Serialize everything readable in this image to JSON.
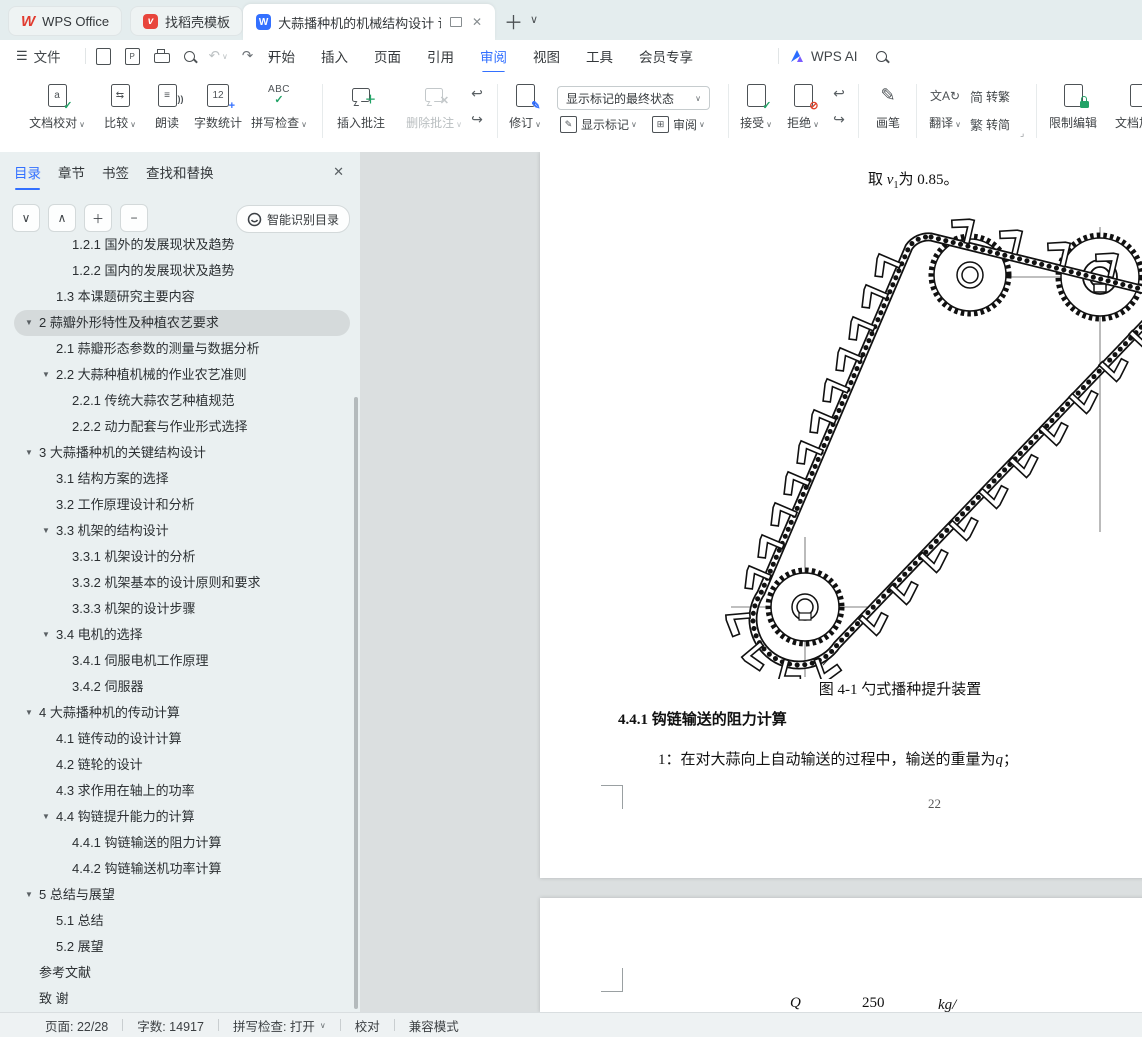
{
  "colors": {
    "accent": "#3370ff",
    "green": "#21a366",
    "red": "#e0442d"
  },
  "tabbar": {
    "tabs": [
      {
        "label": "WPS Office"
      },
      {
        "label": "找稻壳模板"
      },
      {
        "label": "大蒜播种机的机械结构设计 说"
      }
    ]
  },
  "menubar": {
    "file": "文件",
    "tabs": [
      "开始",
      "插入",
      "页面",
      "引用",
      "审阅",
      "视图",
      "工具",
      "会员专享"
    ],
    "active_tab": "审阅",
    "ai": "WPS AI"
  },
  "ribbon": {
    "proof_icon_letter": "a",
    "doc_proof": "文档校对",
    "compare": "比较",
    "read_aloud": "朗读",
    "wc_icon": "12",
    "word_count": "字数统计",
    "spell_icon": "ABC",
    "spell_check": "拼写检查",
    "insert_comment": "插入批注",
    "delete_comment": "删除批注",
    "track_changes": "修订",
    "markup_state": "显示标记的最终状态",
    "show_markup": "显示标记",
    "review_pane": "审阅",
    "accept": "接受",
    "reject": "拒绝",
    "pen": "画笔",
    "translate": "翻译",
    "s2t_icon": "简",
    "s2t": "转繁",
    "t2s_icon": "繁",
    "t2s": "转简",
    "restrict_edit": "限制编辑",
    "encrypt": "文档加密"
  },
  "sidebar": {
    "tabs": [
      "目录",
      "章节",
      "书签",
      "查找和替换"
    ],
    "active_tab": "目录",
    "smart_toc": "智能识别目录",
    "toc": [
      {
        "lv": 3,
        "label": "1.2.1 国外的发展现状及趋势"
      },
      {
        "lv": 3,
        "label": "1.2.2 国内的发展现状及趋势"
      },
      {
        "lv": 2,
        "label": "1.3 本课题研究主要内容"
      },
      {
        "lv": 1,
        "arrow": true,
        "selected": true,
        "label": "2  蒜瓣外形特性及种植农艺要求"
      },
      {
        "lv": 2,
        "label": "2.1  蒜瓣形态参数的测量与数据分析"
      },
      {
        "lv": 2,
        "arrow": true,
        "label": "2.2  大蒜种植机械的作业农艺准则"
      },
      {
        "lv": 3,
        "label": "2.2.1  传统大蒜农艺种植规范"
      },
      {
        "lv": 3,
        "label": "2.2.2  动力配套与作业形式选择"
      },
      {
        "lv": 1,
        "arrow": true,
        "label": "3 大蒜播种机的关键结构设计"
      },
      {
        "lv": 2,
        "label": "3.1 结构方案的选择"
      },
      {
        "lv": 2,
        "label": "3.2 工作原理设计和分析"
      },
      {
        "lv": 2,
        "arrow": true,
        "label": "3.3 机架的结构设计"
      },
      {
        "lv": 3,
        "label": "3.3.1 机架设计的分析"
      },
      {
        "lv": 3,
        "label": "3.3.2 机架基本的设计原则和要求"
      },
      {
        "lv": 3,
        "label": "3.3.3 机架的设计步骤"
      },
      {
        "lv": 2,
        "arrow": true,
        "label": "3.4 电机的选择"
      },
      {
        "lv": 3,
        "label": "3.4.1 伺服电机工作原理"
      },
      {
        "lv": 3,
        "label": "3.4.2 伺服器"
      },
      {
        "lv": 1,
        "arrow": true,
        "label": "4  大蒜播种机的传动计算"
      },
      {
        "lv": 2,
        "label": "4.1 链传动的设计计算"
      },
      {
        "lv": 2,
        "label": "4.2 链轮的设计"
      },
      {
        "lv": 2,
        "label": "4.3 求作用在轴上的功率"
      },
      {
        "lv": 2,
        "arrow": true,
        "label": "4.4 钩链提升能力的计算"
      },
      {
        "lv": 3,
        "label": "4.4.1 钩链输送的阻力计算"
      },
      {
        "lv": 3,
        "label": "4.4.2 钩链输送机功率计算"
      },
      {
        "lv": 1,
        "arrow": true,
        "label": "5  总结与展望"
      },
      {
        "lv": 2,
        "label": "5.1 总结"
      },
      {
        "lv": 2,
        "label": "5.2 展望"
      },
      {
        "lv": 1,
        "label": "参考文献"
      },
      {
        "lv": 1,
        "label": "致   谢"
      }
    ]
  },
  "document": {
    "line_prefix": "取 ",
    "line_var": "v",
    "line_sub": "1",
    "line_rest": "为 0.85。",
    "caption": "图 4-1 勺式播种提升装置",
    "heading": "4.4.1 钩链输送的阻力计算",
    "para_prefix": "1：在对大蒜向上自动输送的过程中，输送的重量为",
    "para_var": "q",
    "para_suffix": "；",
    "page_num": "22",
    "formula": {
      "lhs": "Q",
      "num": "250",
      "unit": "kg/"
    }
  },
  "statusbar": {
    "page": "页面: 22/28",
    "words": "字数: 14917",
    "spell": "拼写检查: 打开",
    "proof": "校对",
    "compat": "兼容模式"
  }
}
